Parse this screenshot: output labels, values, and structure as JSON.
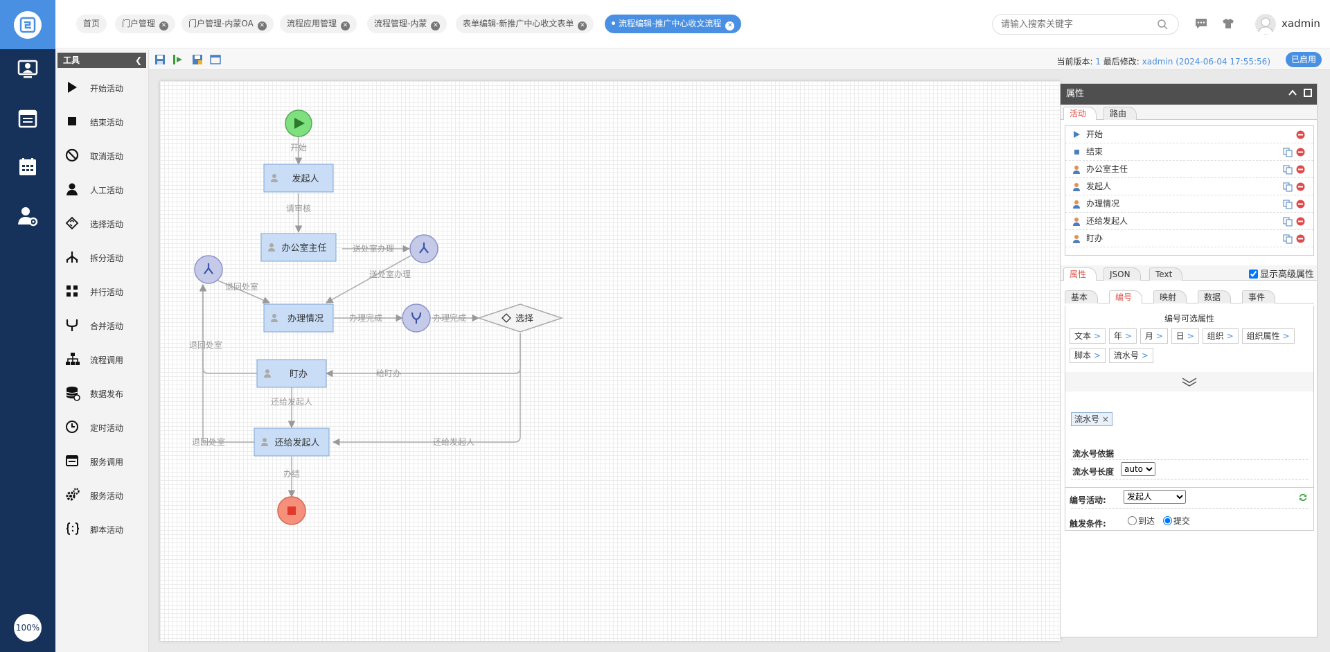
{
  "nav": {
    "zoom": "100%"
  },
  "tabs": [
    {
      "label": "首页",
      "closable": false
    },
    {
      "label": "门户管理",
      "closable": true
    },
    {
      "label": "门户管理-内蒙OA",
      "closable": true
    },
    {
      "label": "流程应用管理",
      "closable": true
    },
    {
      "label": "流程管理-内蒙",
      "closable": true
    },
    {
      "label": "表单编辑-新推广中心收文表单",
      "closable": true
    },
    {
      "label": "流程编辑-推广中心收文流程",
      "closable": true,
      "active": true
    }
  ],
  "header": {
    "search_placeholder": "请输入搜索关键字",
    "username": "xadmin"
  },
  "toolbar": {
    "version_label": "当前版本:",
    "version_value": "1",
    "modified_label": "最后修改:",
    "modified_value": "xadmin (2024-06-04 17:55:56)",
    "status": "已启用"
  },
  "tools": {
    "title": "工具",
    "items": [
      {
        "label": "开始活动",
        "icon": "play-icon"
      },
      {
        "label": "结束活动",
        "icon": "stop-icon"
      },
      {
        "label": "取消活动",
        "icon": "cancel-icon"
      },
      {
        "label": "人工活动",
        "icon": "person-icon"
      },
      {
        "label": "选择活动",
        "icon": "choice-icon"
      },
      {
        "label": "拆分活动",
        "icon": "split-icon"
      },
      {
        "label": "并行活动",
        "icon": "parallel-icon"
      },
      {
        "label": "合并活动",
        "icon": "merge-icon"
      },
      {
        "label": "流程调用",
        "icon": "hierarchy-icon"
      },
      {
        "label": "数据发布",
        "icon": "database-icon"
      },
      {
        "label": "定时活动",
        "icon": "clock-icon"
      },
      {
        "label": "服务调用",
        "icon": "window-icon"
      },
      {
        "label": "服务活动",
        "icon": "gear-icon"
      },
      {
        "label": "脚本活动",
        "icon": "braces-icon"
      }
    ]
  },
  "flow": {
    "nodes": {
      "start": "开始",
      "faqiren": "发起人",
      "bangongshi": "办公室主任",
      "banli": "办理情况",
      "dingban": "盯办",
      "huangei": "还给发起人",
      "choose": "选择"
    },
    "edges": {
      "e1": "开始",
      "e2": "请审核",
      "e3": "送处室办理",
      "e4": "送处室办理",
      "e5": "退回处室",
      "e6": "办理完成",
      "e7": "办理完成",
      "e8": "给盯办",
      "e9": "退回处室",
      "e10": "还给发起人",
      "e11": "退回处室",
      "e12": "还给发起人",
      "e13": "办结"
    }
  },
  "props": {
    "title": "属性",
    "top_tabs": [
      "活动",
      "路由"
    ],
    "activities": [
      {
        "label": "开始",
        "type": "start",
        "copy": false
      },
      {
        "label": "结束",
        "type": "end",
        "copy": true
      },
      {
        "label": "办公室主任",
        "type": "person",
        "copy": true
      },
      {
        "label": "发起人",
        "type": "person",
        "copy": true
      },
      {
        "label": "办理情况",
        "type": "person",
        "copy": true
      },
      {
        "label": "还给发起人",
        "type": "person",
        "copy": true
      },
      {
        "label": "盯办",
        "type": "person",
        "copy": true
      }
    ],
    "attr_tabs": [
      "属性",
      "JSON",
      "Text"
    ],
    "show_advanced": "显示高级属性",
    "inner_tabs": [
      "基本",
      "编号",
      "映射",
      "数据",
      "事件"
    ],
    "number": {
      "title": "编号可选属性",
      "chips": [
        "文本",
        "年",
        "月",
        "日",
        "组织",
        "组织属性",
        "脚本",
        "流水号"
      ],
      "selected": "流水号",
      "seq_basis": "流水号依据",
      "seq_length": "流水号长度",
      "seq_length_value": "auto",
      "activity_label": "编号活动:",
      "activity_value": "发起人",
      "trigger_label": "触发条件:",
      "trigger_options": [
        "到达",
        "提交"
      ],
      "trigger_selected": "提交"
    }
  }
}
